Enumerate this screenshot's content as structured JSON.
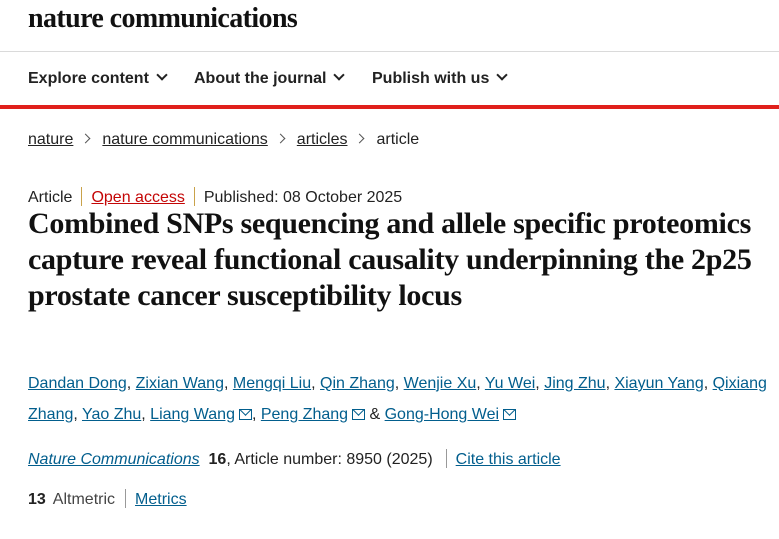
{
  "header": {
    "logo": "nature communications"
  },
  "nav": {
    "items": [
      {
        "label": "Explore content"
      },
      {
        "label": "About the journal"
      },
      {
        "label": "Publish with us"
      }
    ]
  },
  "breadcrumb": {
    "items": [
      "nature",
      "nature communications",
      "articles",
      "article"
    ]
  },
  "meta": {
    "type": "Article",
    "access": "Open access",
    "published": "Published: 08 October 2025"
  },
  "title": "Combined SNPs sequencing and allele specific proteomics capture reveal functional causality underpinning the 2p25 prostate cancer susceptibility locus",
  "authors": [
    {
      "name": "Dandan Dong"
    },
    {
      "name": "Zixian Wang"
    },
    {
      "name": "Mengqi Liu"
    },
    {
      "name": "Qin Zhang"
    },
    {
      "name": "Wenjie Xu"
    },
    {
      "name": "Yu Wei"
    },
    {
      "name": "Jing Zhu"
    },
    {
      "name": "Xiayun Yang"
    },
    {
      "name": "Qixiang Zhang"
    },
    {
      "name": "Yao Zhu"
    },
    {
      "name": "Liang Wang",
      "mail": true
    },
    {
      "name": "Peng Zhang",
      "mail": true
    },
    {
      "name": "Gong-Hong Wei",
      "mail": true
    }
  ],
  "authors_separator": ", ",
  "authors_and": " & ",
  "citation": {
    "journal": "Nature Communications",
    "volume": "16",
    "rest": ", Article number: 8950 (2025)",
    "cite_link": "Cite this article"
  },
  "metrics": {
    "altmetric_value": "13",
    "altmetric_label": "Altmetric",
    "metrics_link": "Metrics"
  },
  "colors": {
    "accent_red": "#e0201b",
    "link_blue": "#025e8d",
    "open_access_red": "#c40606"
  }
}
